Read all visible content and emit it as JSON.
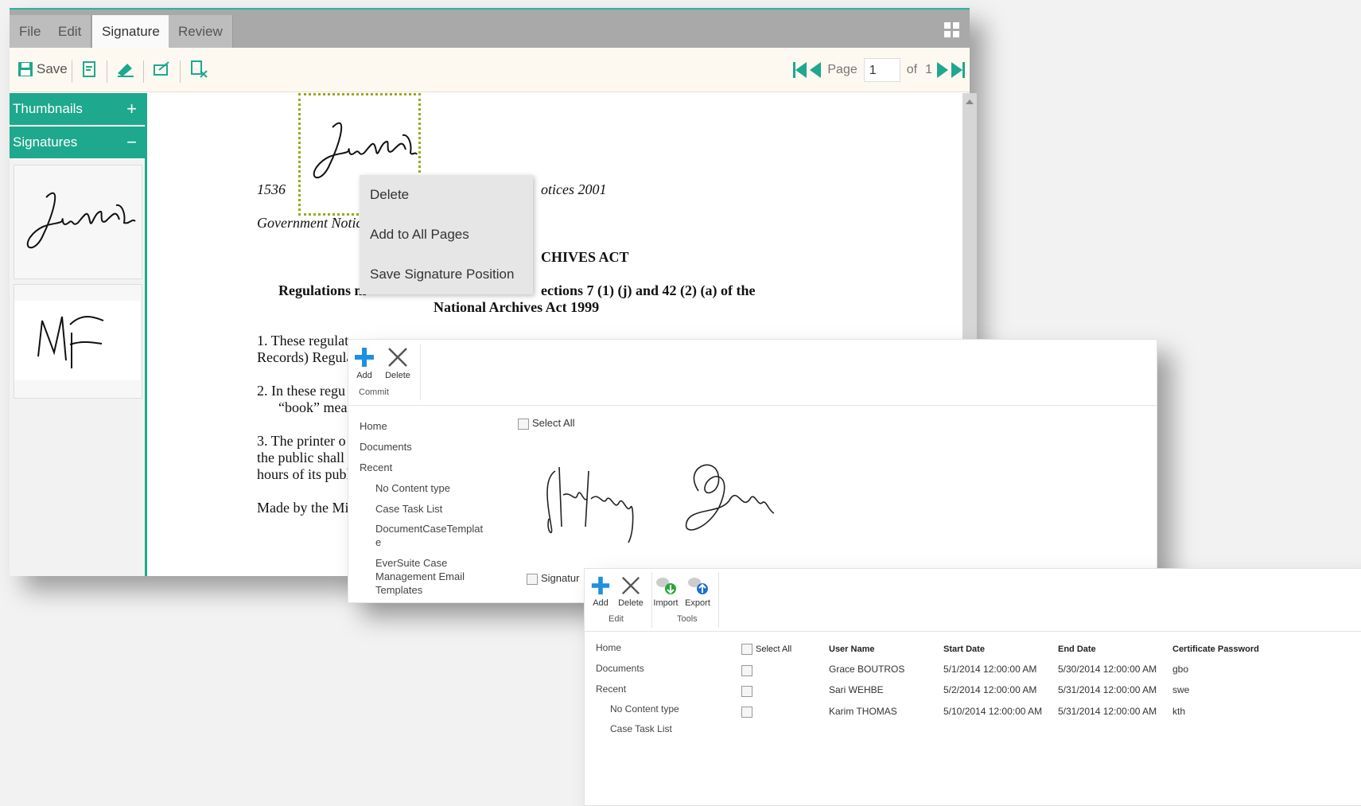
{
  "viewer": {
    "tabs": [
      "File",
      "Edit",
      "Signature",
      "Review"
    ],
    "active_tab": "Signature",
    "toolbar": {
      "save_label": "Save"
    },
    "pager": {
      "page_label": "Page",
      "page_value": "1",
      "of_label": "of",
      "total": "1"
    },
    "sidebar": {
      "thumbnails_label": "Thumbnails",
      "thumbnails_toggle": "+",
      "signatures_label": "Signatures",
      "signatures_toggle": "−"
    },
    "document": {
      "page_num": "1536",
      "notices_tail": "otices 2001",
      "gov_notice": "Government Notic",
      "act_title_tail": "CHIVES ACT",
      "reg_line1_head": "Regulations m",
      "reg_line1_tail": "ections 7 (1) (j) and 42 (2) (a) of the",
      "reg_line2": "National Archives Act 1999",
      "p1_line1": "1.   These regulat",
      "p1_line2": "Records) Regula",
      "p2_line1": "2.   In these regu",
      "p2_line2": "“book” mean",
      "p3_line1": "3.   The printer o",
      "p3_line2": "the public shall c",
      "p3_line3": "hours of its publi",
      "p4_line1": "Made by the Mir"
    },
    "context_menu": [
      "Delete",
      "Add to All Pages",
      "Save Signature Position"
    ]
  },
  "signatures_list": {
    "ribbon": {
      "add": "Add",
      "delete": "Delete",
      "group": "Commit"
    },
    "nav": {
      "home": "Home",
      "documents": "Documents",
      "recent": "Recent",
      "sub": [
        "No Content type",
        "Case Task List",
        "DocumentCaseTemplat",
        "e",
        "EverSuite Case",
        "Management Email",
        "Templates"
      ]
    },
    "select_all": "Select All",
    "signature_col": "Signatur"
  },
  "certificates": {
    "ribbon": {
      "add": "Add",
      "delete": "Delete",
      "import": "Import",
      "export": "Export",
      "edit_group": "Edit",
      "tools_group": "Tools"
    },
    "nav": {
      "home": "Home",
      "documents": "Documents",
      "recent": "Recent",
      "sub": [
        "No Content type",
        "Case Task List"
      ]
    },
    "columns": [
      "Select All",
      "User Name",
      "Start Date",
      "End Date",
      "Certificate Password"
    ],
    "rows": [
      {
        "user": "Grace BOUTROS",
        "start": "5/1/2014 12:00:00 AM",
        "end": "5/30/2014 12:00:00 AM",
        "password": "gbo"
      },
      {
        "user": "Sari WEHBE",
        "start": "5/2/2014 12:00:00 AM",
        "end": "5/31/2014 12:00:00 AM",
        "password": "swe"
      },
      {
        "user": "Karim THOMAS",
        "start": "5/10/2014 12:00:00 AM",
        "end": "5/31/2014 12:00:00 AM",
        "password": "kth"
      }
    ]
  },
  "colors": {
    "accent": "#1ea88e",
    "sig_box": "#9aa818",
    "link": "#1a6fb8",
    "add_blue": "#1e90e0"
  }
}
